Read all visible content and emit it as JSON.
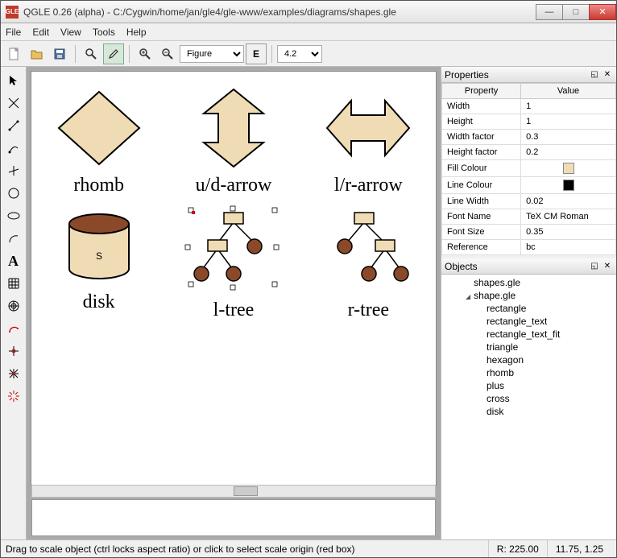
{
  "window": {
    "title": "QGLE 0.26 (alpha) - C:/Cygwin/home/jan/gle4/gle-www/examples/diagrams/shapes.gle",
    "app_badge": "GLE"
  },
  "menu": {
    "file": "File",
    "edit": "Edit",
    "view": "View",
    "tools": "Tools",
    "help": "Help"
  },
  "toolbar": {
    "figure_dropdown": "Figure",
    "zoom_dropdown": "4.2"
  },
  "shapes": {
    "rhomb": "rhomb",
    "udarrow": "u/d-arrow",
    "lrarrow": "l/r-arrow",
    "disk": "disk",
    "disk_letter": "S",
    "ltree": "l-tree",
    "rtree": "r-tree"
  },
  "properties": {
    "header": "Properties",
    "col_property": "Property",
    "col_value": "Value",
    "rows": [
      {
        "name": "Width",
        "value": "1"
      },
      {
        "name": "Height",
        "value": "1"
      },
      {
        "name": "Width factor",
        "value": "0.3"
      },
      {
        "name": "Height factor",
        "value": "0.2"
      },
      {
        "name": "Fill Colour",
        "value": "#f0dcb4",
        "is_color": true
      },
      {
        "name": "Line Colour",
        "value": "#000000",
        "is_color": true
      },
      {
        "name": "Line Width",
        "value": "0.02"
      },
      {
        "name": "Font Name",
        "value": "TeX CM Roman"
      },
      {
        "name": "Font Size",
        "value": "0.35"
      },
      {
        "name": "Reference",
        "value": "bc"
      }
    ]
  },
  "objects": {
    "header": "Objects",
    "items": [
      {
        "label": "shapes.gle",
        "level": 0
      },
      {
        "label": "shape.gle",
        "level": 1
      },
      {
        "label": "rectangle",
        "level": 2
      },
      {
        "label": "rectangle_text",
        "level": 2
      },
      {
        "label": "rectangle_text_fit",
        "level": 2
      },
      {
        "label": "triangle",
        "level": 2
      },
      {
        "label": "hexagon",
        "level": 2
      },
      {
        "label": "rhomb",
        "level": 2
      },
      {
        "label": "plus",
        "level": 2
      },
      {
        "label": "cross",
        "level": 2
      },
      {
        "label": "disk",
        "level": 2
      }
    ]
  },
  "status": {
    "hint": "Drag to scale object (ctrl locks aspect ratio) or click to select scale origin (red box)",
    "r": "R:  225.00",
    "coords": "11.75, 1.25"
  },
  "colors": {
    "shape_fill": "#f0dcb4",
    "tree_node": "#8a4a2a"
  }
}
